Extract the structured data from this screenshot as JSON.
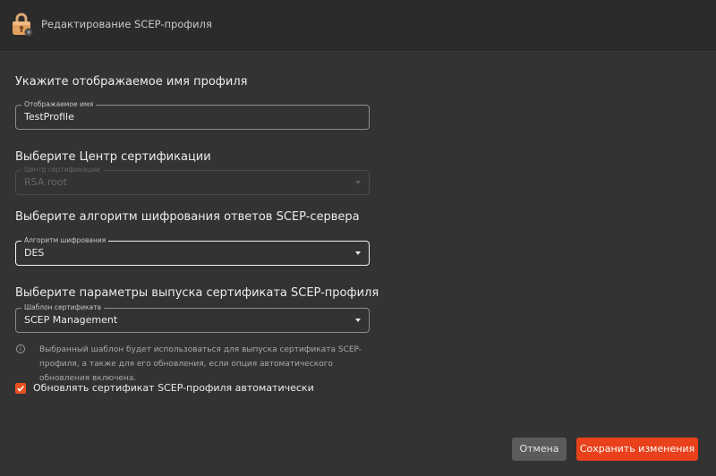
{
  "window": {
    "title": "Редактирование SCEP-профиля",
    "icon": "lock-icon"
  },
  "sections": {
    "name": {
      "heading": "Укажите отображаемое имя профиля",
      "field_label": "Отображаемое имя",
      "field_value": "TestProfile"
    },
    "ca": {
      "heading": "Выберите Центр сертификации",
      "field_label": "Центр сертификации",
      "field_value": "RSA root",
      "disabled": true
    },
    "cipher": {
      "heading": "Выберите алгоритм шифрования ответов SCEP-сервера",
      "field_label": "Алгоритм шифрования",
      "field_value": "DES"
    },
    "template": {
      "heading": "Выберите параметры выпуска сертификата SCEP-профиля",
      "field_label": "Шаблон сертификата",
      "field_value": "SCEP Management",
      "hint": "Выбранный шаблон будет использоваться для выпуска сертификата SCEP-профиля, а также для его обновления, если опция автоматического обновления включена."
    }
  },
  "auto_renew": {
    "label": "Обновлять сертификат SCEP-профиля автоматически",
    "checked": true
  },
  "buttons": {
    "cancel": "Отмена",
    "save": "Сохранить изменения"
  },
  "colors": {
    "accent": "#e8411c",
    "background": "#333334",
    "titlebar": "#2b2b2c"
  }
}
